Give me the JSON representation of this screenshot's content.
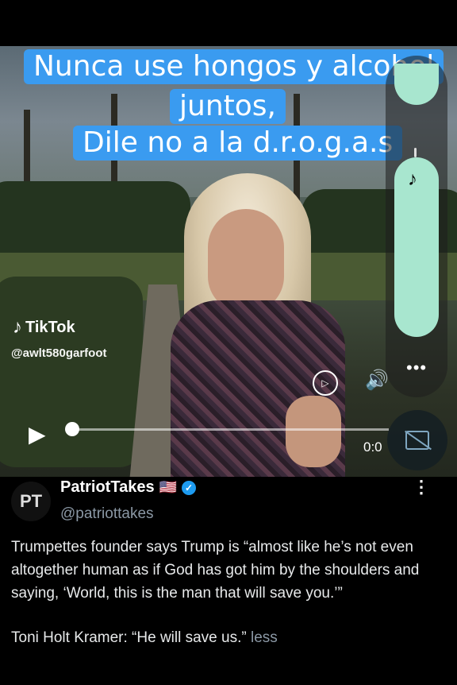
{
  "video": {
    "caption_lines": [
      "Nunca use  hongos y alcohol",
      "juntos,",
      "Dile no a la d.r.o.g.a.s"
    ],
    "watermark": {
      "brand": "TikTok",
      "handle": "@awlt580garfoot"
    },
    "time_label": "0:0",
    "progress": 0.0
  },
  "side_panel": {
    "music_icon": "music-note-icon",
    "more_label": "•••"
  },
  "icons": {
    "play": "▶",
    "volume": "🔊",
    "replay": "▷",
    "cc": "captions-off-icon"
  },
  "post": {
    "avatar_text": "PT",
    "author": "PatriotTakes",
    "flag": "🇺🇸",
    "verified": "✓",
    "username": "@patriottakes",
    "more": "⋮",
    "paragraph1": "Trumpettes founder says Trump is “almost like he’s not even altogether human as if God has got him by the shoulders and saying, ‘World, this is the man that will save you.’”",
    "paragraph2": "Toni Holt Kramer: “He will save us.”",
    "less_label": "less"
  },
  "colors": {
    "caption_bg": "#3a9bf0",
    "pill": "#a8e6cf",
    "verified": "#1d9bf0",
    "muted": "#8b98a5"
  }
}
